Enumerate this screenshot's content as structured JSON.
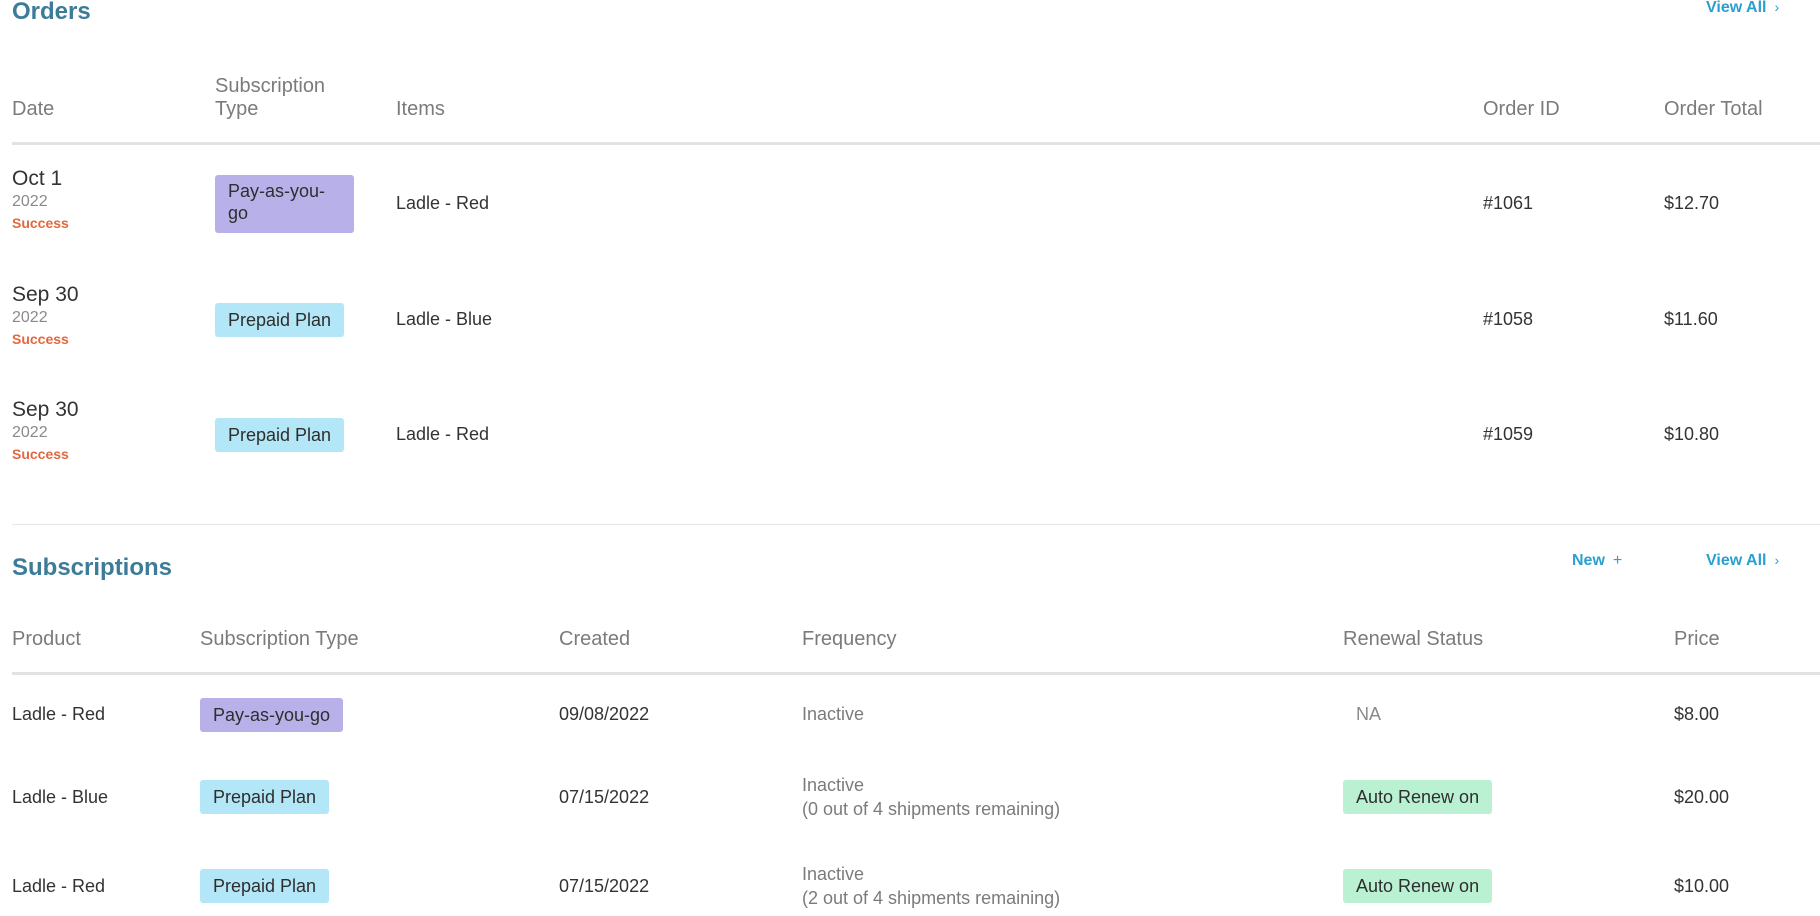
{
  "orders": {
    "title": "Orders",
    "view_all": "View All",
    "chevron": "›",
    "columns": {
      "date": "Date",
      "subscription_type_line1": "Subscription",
      "subscription_type_line2": "Type",
      "items": "Items",
      "order_id": "Order ID",
      "order_total": "Order Total"
    },
    "rows": [
      {
        "date": "Oct 1",
        "year": "2022",
        "status": "Success",
        "type_line1": "Pay-as-you-",
        "type_line2": "go",
        "item": "Ladle - Red",
        "order_id": "#1061",
        "total": "$12.70"
      },
      {
        "date": "Sep 30",
        "year": "2022",
        "status": "Success",
        "type": "Prepaid Plan",
        "item": "Ladle - Blue",
        "order_id": "#1058",
        "total": "$11.60"
      },
      {
        "date": "Sep 30",
        "year": "2022",
        "status": "Success",
        "type": "Prepaid Plan",
        "item": "Ladle - Red",
        "order_id": "#1059",
        "total": "$10.80"
      }
    ]
  },
  "subscriptions": {
    "title": "Subscriptions",
    "new_label": "New",
    "plus": "+",
    "view_all": "View All",
    "chevron": "›",
    "columns": {
      "product": "Product",
      "subscription_type": "Subscription Type",
      "created": "Created",
      "frequency": "Frequency",
      "renewal_status": "Renewal Status",
      "price": "Price"
    },
    "rows": [
      {
        "product": "Ladle - Red",
        "type": "Pay-as-you-go",
        "created": "09/08/2022",
        "frequency": "Inactive",
        "renewal": "NA",
        "price": "$8.00"
      },
      {
        "product": "Ladle - Blue",
        "type": "Prepaid Plan",
        "created": "07/15/2022",
        "frequency": "Inactive",
        "frequency_detail": "(0 out of 4 shipments remaining)",
        "renewal": "Auto Renew on",
        "price": "$20.00"
      },
      {
        "product": "Ladle - Red",
        "type": "Prepaid Plan",
        "created": "07/15/2022",
        "frequency": "Inactive",
        "frequency_detail": "(2 out of 4 shipments remaining)",
        "renewal": "Auto Renew on",
        "price": "$10.00"
      }
    ]
  },
  "colors": {
    "title": "#3d7c99",
    "link": "#2a9fd0",
    "success": "#e5673d",
    "badge_pay_as_you_go": "#b8b1e9",
    "badge_prepaid": "#b3e6f6",
    "badge_auto_renew": "#b9f1d2"
  }
}
